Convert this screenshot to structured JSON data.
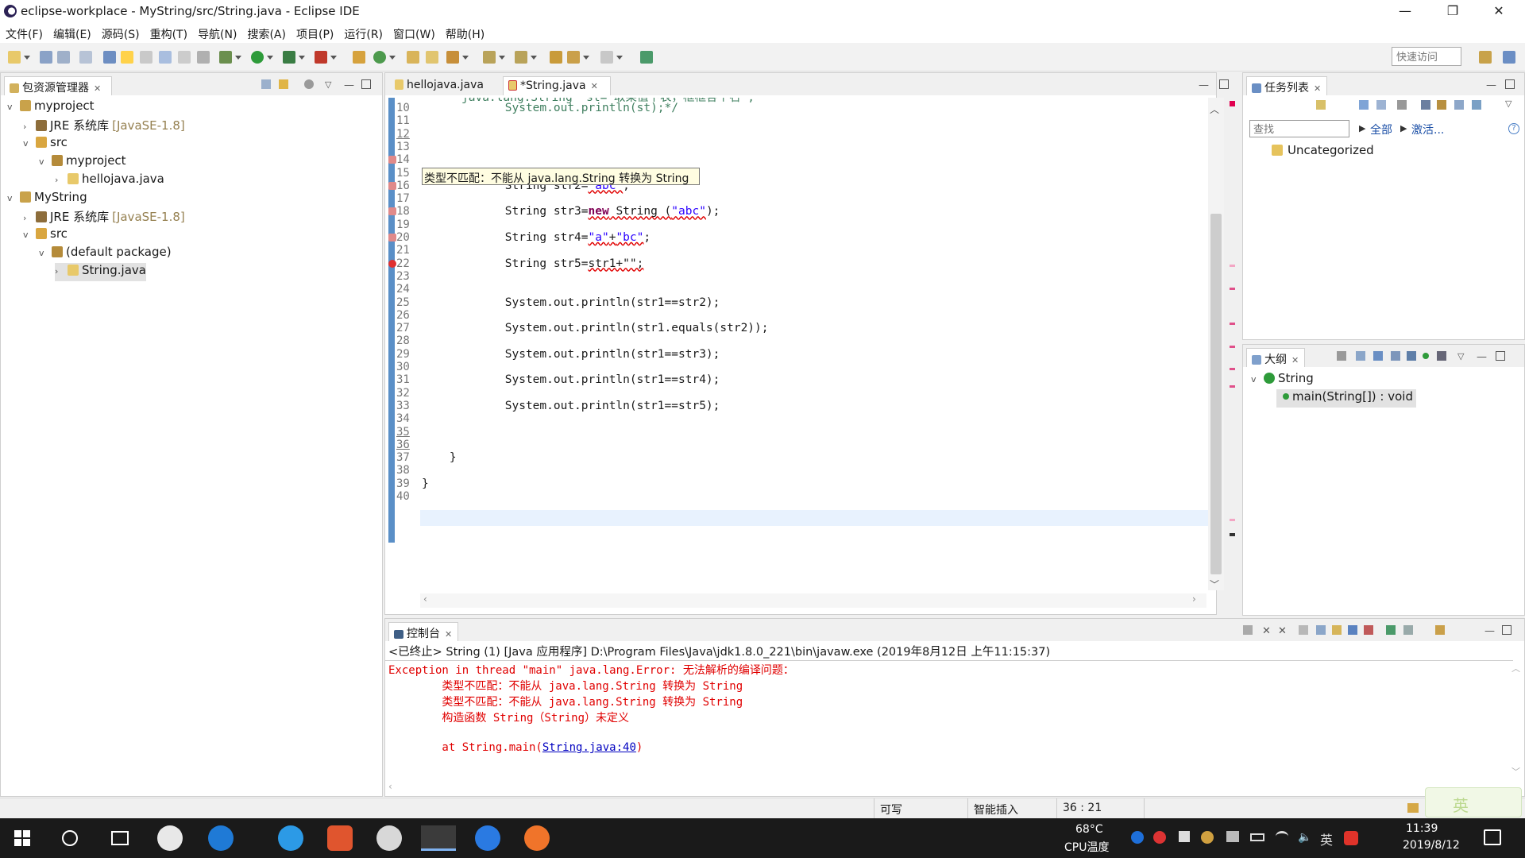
{
  "window": {
    "title": "eclipse-workplace - MyString/src/String.java - Eclipse IDE"
  },
  "menu": [
    "文件(F)",
    "编辑(E)",
    "源码(S)",
    "重构(T)",
    "导航(N)",
    "搜索(A)",
    "项目(P)",
    "运行(R)",
    "窗口(W)",
    "帮助(H)"
  ],
  "quick_access": {
    "placeholder": "快速访问"
  },
  "package_explorer": {
    "title": "包资源管理器",
    "tree": [
      {
        "label": "myproject",
        "level": 0,
        "expanded": true
      },
      {
        "label": "JRE 系统库",
        "extra": "[JavaSE-1.8]",
        "level": 1,
        "expanded": false
      },
      {
        "label": "src",
        "level": 1,
        "expanded": true
      },
      {
        "label": "myproject",
        "level": 2,
        "expanded": true
      },
      {
        "label": "hellojava.java",
        "level": 3,
        "expanded": false
      },
      {
        "label": "MyString",
        "level": 0,
        "expanded": true
      },
      {
        "label": "JRE 系统库",
        "extra": "[JavaSE-1.8]",
        "level": 1,
        "expanded": false
      },
      {
        "label": "src",
        "level": 1,
        "expanded": true
      },
      {
        "label": "(default package)",
        "level": 2,
        "expanded": true
      },
      {
        "label": "String.java",
        "level": 3,
        "expanded": false,
        "selected": true
      }
    ]
  },
  "editor": {
    "tabs": [
      {
        "label": "hellojava.java",
        "active": false
      },
      {
        "label": "*String.java",
        "active": true
      }
    ],
    "tooltip": "类型不匹配：不能从 java.lang.String 转换为 String",
    "top_partial": "java.lang.String  st=\"取某值下表，框框各个名\";",
    "lines": {
      "10": "            System.out.println(st);*/",
      "16a": "            String str2=",
      "16b": "\"abc\"",
      "16c": ";",
      "18a": "            String str3=",
      "18b": "new",
      "18c": " String (",
      "18d": "\"abc\"",
      "18e": ");",
      "20a": "            String str4=",
      "20b": "\"a\"",
      "20c": "+",
      "20d": "\"bc\"",
      "20e": ";",
      "22a": "            String str5=",
      "22b": "str1+\"\";",
      "25": "            System.out.println(str1==str2);",
      "27": "            System.out.println(str1.equals(str2));",
      "29": "            System.out.println(str1==str3);",
      "31": "            System.out.println(str1==str4);",
      "33": "            System.out.println(str1==str5);",
      "37": "    }",
      "39": "}"
    }
  },
  "task_list": {
    "title": "任务列表",
    "find_placeholder": "查找",
    "all": "全部",
    "activate": "激活...",
    "category": "Uncategorized"
  },
  "outline": {
    "title": "大纲",
    "class": "String",
    "method": "main(String[]) : void"
  },
  "console": {
    "title": "控制台",
    "header": "<已终止> String (1)  [Java 应用程序] D:\\Program Files\\Java\\jdk1.8.0_221\\bin\\javaw.exe  (2019年8月12日 上午11:15:37)",
    "lines": [
      "Exception in thread \"main\" java.lang.Error: 无法解析的编译问题：",
      "        类型不匹配：不能从 java.lang.String 转换为 String",
      "        类型不匹配：不能从 java.lang.String 转换为 String",
      "        构造函数 String（String）未定义",
      ""
    ],
    "trace_prefix": "        at String.main(",
    "trace_link": "String.java:40",
    "trace_suffix": ")"
  },
  "status_bar": {
    "writable": "可写",
    "insert_mode": "智能插入",
    "position": "36 : 21"
  },
  "taskbar": {
    "temp": "68°C",
    "temp_label": "CPU温度",
    "time": "11:39",
    "date": "2019/8/12",
    "ime": "英"
  }
}
